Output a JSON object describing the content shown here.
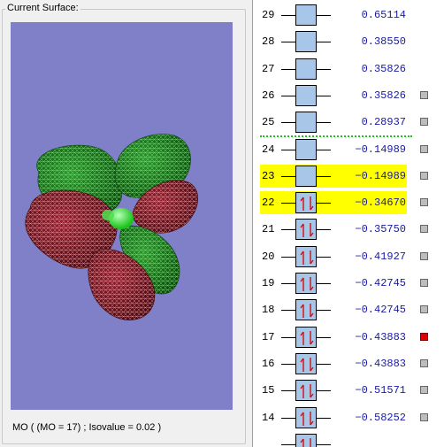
{
  "panel": {
    "title": "Current Surface:",
    "caption": "MO ( (MO = 17) ; Isovalue = 0.02 )"
  },
  "colors": {
    "viewport_background": "#8080c8",
    "positive_lobe": "green",
    "negative_lobe": "dark red",
    "highlight": "#ffff00",
    "selected_marker": "#e00000",
    "homo_lumo_separator": "#19c519"
  },
  "orbitals": [
    {
      "num": "29",
      "energy": "0.65114",
      "electrons": 0,
      "marker": "none",
      "highlight": false
    },
    {
      "num": "28",
      "energy": "0.38550",
      "electrons": 0,
      "marker": "none",
      "highlight": false
    },
    {
      "num": "27",
      "energy": "0.35826",
      "electrons": 0,
      "marker": "none",
      "highlight": false
    },
    {
      "num": "26",
      "energy": "0.35826",
      "electrons": 0,
      "marker": "gray",
      "highlight": false
    },
    {
      "num": "25",
      "energy": "0.28937",
      "electrons": 0,
      "marker": "gray",
      "highlight": false
    },
    {
      "num": "24",
      "energy": "−0.14989",
      "electrons": 0,
      "marker": "gray",
      "highlight": false
    },
    {
      "num": "23",
      "energy": "−0.14989",
      "electrons": 0,
      "marker": "gray",
      "highlight": true
    },
    {
      "num": "22",
      "energy": "−0.34670",
      "electrons": 2,
      "marker": "gray",
      "highlight": true
    },
    {
      "num": "21",
      "energy": "−0.35750",
      "electrons": 2,
      "marker": "gray",
      "highlight": false
    },
    {
      "num": "20",
      "energy": "−0.41927",
      "electrons": 2,
      "marker": "gray",
      "highlight": false
    },
    {
      "num": "19",
      "energy": "−0.42745",
      "electrons": 2,
      "marker": "gray",
      "highlight": false
    },
    {
      "num": "18",
      "energy": "−0.42745",
      "electrons": 2,
      "marker": "gray",
      "highlight": false
    },
    {
      "num": "17",
      "energy": "−0.43883",
      "electrons": 2,
      "marker": "red",
      "highlight": false
    },
    {
      "num": "16",
      "energy": "−0.43883",
      "electrons": 2,
      "marker": "gray",
      "highlight": false
    },
    {
      "num": "15",
      "energy": "−0.51571",
      "electrons": 2,
      "marker": "gray",
      "highlight": false
    },
    {
      "num": "14",
      "energy": "−0.58252",
      "electrons": 2,
      "marker": "gray",
      "highlight": false
    },
    {
      "num": "",
      "energy": "",
      "electrons": 2,
      "marker": "none",
      "highlight": false
    }
  ]
}
